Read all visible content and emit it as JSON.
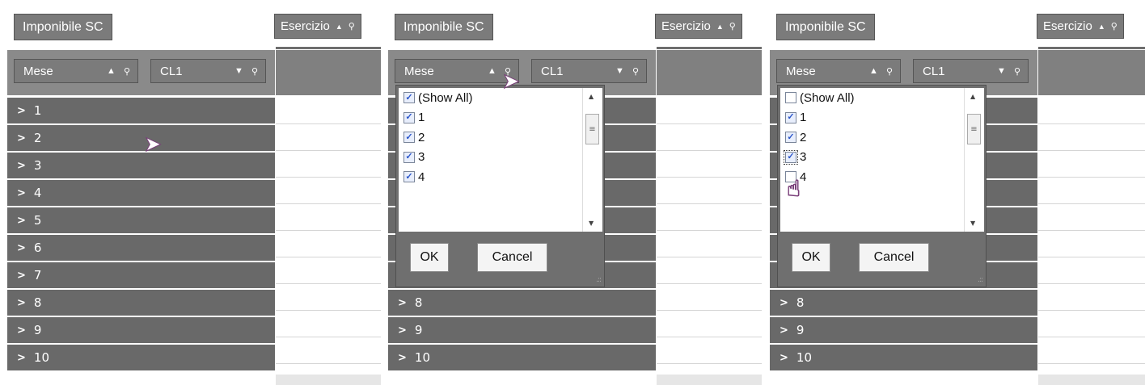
{
  "header": {
    "title_label": "Imponibile SC",
    "esercizio_label": "Esercizio",
    "mese_label": "Mese",
    "cl1_label": "CL1"
  },
  "icons": {
    "sort_up": "▲",
    "sort_down": "▼",
    "filter": "⚲",
    "chevron": ">"
  },
  "rows": [
    "1",
    "2",
    "3",
    "4",
    "5",
    "6",
    "7",
    "8",
    "9",
    "10"
  ],
  "dropdown": {
    "items": [
      {
        "label": "(Show All)"
      },
      {
        "label": "1"
      },
      {
        "label": "2"
      },
      {
        "label": "3"
      },
      {
        "label": "4"
      }
    ],
    "panel2_checked": [
      true,
      true,
      true,
      true,
      true
    ],
    "panel3_checked": [
      false,
      true,
      true,
      true,
      false
    ],
    "ok_label": "OK",
    "cancel_label": "Cancel"
  }
}
